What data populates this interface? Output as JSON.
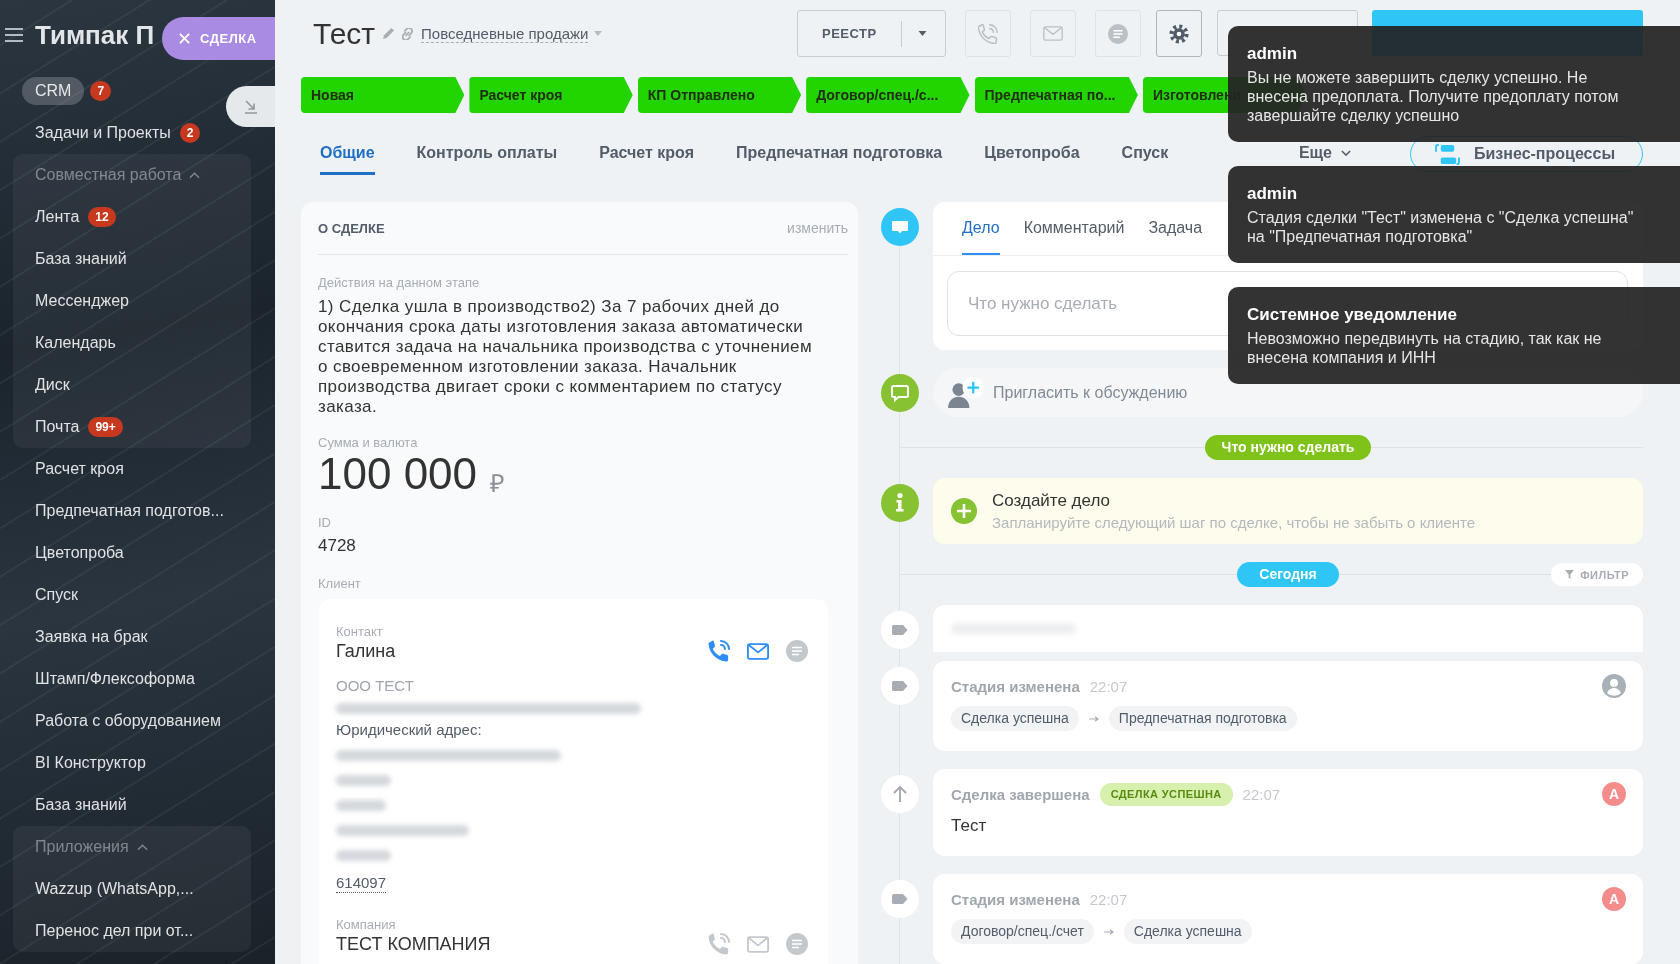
{
  "slider_tab": {
    "label": "СДЕЛКА"
  },
  "sidebar": {
    "title": "Тимпак П",
    "items": [
      {
        "kind": "item",
        "label": "CRM",
        "badge": "7",
        "selected": true
      },
      {
        "kind": "item",
        "label": "Задачи и Проекты",
        "badge": "2",
        "selected": false
      },
      {
        "kind": "group",
        "label": "Совместная работа",
        "expanded": true,
        "children": [
          {
            "kind": "item",
            "label": "Лента",
            "badge": "12",
            "selected": false
          },
          {
            "kind": "item",
            "label": "База знаний",
            "selected": false
          },
          {
            "kind": "item",
            "label": "Мессенджер",
            "selected": false
          },
          {
            "kind": "item",
            "label": "Календарь",
            "selected": false
          },
          {
            "kind": "item",
            "label": "Диск",
            "selected": false
          },
          {
            "kind": "item",
            "label": "Почта",
            "badge": "99+",
            "selected": false
          }
        ]
      },
      {
        "kind": "item",
        "label": "Расчет кроя",
        "selected": false
      },
      {
        "kind": "item",
        "label": "Предпечатная подготов...",
        "selected": false
      },
      {
        "kind": "item",
        "label": "Цветопроба",
        "selected": false
      },
      {
        "kind": "item",
        "label": "Спуск",
        "selected": false
      },
      {
        "kind": "item",
        "label": "Заявка на брак",
        "selected": false
      },
      {
        "kind": "item",
        "label": "Штамп/Флексоформа",
        "selected": false
      },
      {
        "kind": "item",
        "label": "Работа с оборудованием",
        "selected": false
      },
      {
        "kind": "item",
        "label": "BI Конструктор",
        "selected": false
      },
      {
        "kind": "item",
        "label": "База знаний",
        "selected": false
      },
      {
        "kind": "group",
        "label": "Приложения",
        "expanded": true,
        "children": [
          {
            "kind": "item",
            "label": "Wazzup (WhatsApp,...",
            "selected": false
          },
          {
            "kind": "item",
            "label": "Перенос дел при от...",
            "selected": false
          }
        ]
      }
    ]
  },
  "header": {
    "title": "Тест",
    "pipeline": "Повседневные продажи",
    "registry_button": "РЕЕСТР"
  },
  "stages": [
    {
      "label": "Новая",
      "passed": true
    },
    {
      "label": "Расчет кроя",
      "passed": true
    },
    {
      "label": "КП Отправлено",
      "passed": true
    },
    {
      "label": "Договор/спец./с...",
      "passed": true
    },
    {
      "label": "Предпечатная по...",
      "passed": true
    },
    {
      "label": "Изготовлени",
      "passed": true
    }
  ],
  "tabs": [
    {
      "label": "Общие",
      "selected": true
    },
    {
      "label": "Контроль оплаты",
      "selected": false
    },
    {
      "label": "Расчет кроя",
      "selected": false
    },
    {
      "label": "Предпечатная подготовка",
      "selected": false
    },
    {
      "label": "Цветопроба",
      "selected": false
    },
    {
      "label": "Спуск",
      "selected": false
    }
  ],
  "tabs_more": "Еще",
  "business_processes_button": "Бизнес-процессы",
  "deal_card": {
    "title": "О СДЕЛКЕ",
    "edit_link": "изменить",
    "stage_actions": {
      "label": "Действия на данном этапе",
      "value": "1) Сделка ушла в производство2) За 7 рабочих дней до окончания срока даты изготовления заказа автоматически ставится задача на начальника производства с уточнением о своевременном изготовлении заказа. Начальник производства двигает сроки с комментарием по статусу заказа."
    },
    "amount": {
      "label": "Сумма и валюта",
      "value": "100 000",
      "currency": "₽"
    },
    "id": {
      "label": "ID",
      "value": "4728"
    },
    "client": {
      "label": "Клиент",
      "contact": {
        "label": "Контакт",
        "name": "Галина",
        "channels": [
          {
            "kind": "phone",
            "active": true
          },
          {
            "kind": "email",
            "active": true
          },
          {
            "kind": "chat",
            "active": false
          }
        ],
        "company": "ООО ТЕСТ",
        "address_label": "Юридический адрес:",
        "postal_code": "614097"
      },
      "company": {
        "label": "Компания",
        "name": "ТЕСТ КОМПАНИЯ",
        "channels": [
          {
            "kind": "phone",
            "active": false
          },
          {
            "kind": "email",
            "active": false
          },
          {
            "kind": "chat",
            "active": false
          }
        ]
      }
    }
  },
  "timeline": {
    "editor": {
      "tabs": [
        {
          "label": "Дело",
          "selected": true
        },
        {
          "label": "Комментарий",
          "selected": false
        },
        {
          "label": "Задача",
          "selected": false
        }
      ],
      "placeholder": "Что нужно сделать"
    },
    "invite": "Пригласить к обсуждению",
    "planned_label": "Что нужно сделать",
    "create": {
      "title": "Создайте дело",
      "hint": "Запланируйте следующий шаг по сделке, чтобы не забыть о клиенте"
    },
    "today_label": "Сегодня",
    "filter_button": "ФИЛЬТР",
    "events": [
      {
        "kind": "redacted"
      },
      {
        "kind": "stage_change",
        "title": "Стадия изменена",
        "time": "22:07",
        "from": "Сделка успешна",
        "to": "Предпечатная подготовка",
        "author": {
          "kind": "silhouette"
        }
      },
      {
        "kind": "deal_closed",
        "title": "Сделка завершена",
        "badge": "СДЕЛКА УСПЕШНА",
        "time": "22:07",
        "text": "Тест",
        "author": {
          "kind": "initial",
          "initial": "A"
        }
      },
      {
        "kind": "stage_change",
        "title": "Стадия изменена",
        "time": "22:07",
        "from": "Договор/спец./счет",
        "to": "Сделка успешна",
        "author": {
          "kind": "initial",
          "initial": "A"
        }
      }
    ]
  },
  "notifications": [
    {
      "title": "admin",
      "text": "Вы не можете завершить сделку успешно. Не внесена предоплата. Получите предоплату потом завершайте сделку успешно"
    },
    {
      "title": "admin",
      "text": "Стадия сделки \"Тест\" изменена с \"Сделка успешна\" на \"Предпечатная подготовка\""
    },
    {
      "title": "Системное уведомление",
      "text": "Невозможно передвинуть на стадию, так как не внесена компания и ИНН"
    }
  ]
}
